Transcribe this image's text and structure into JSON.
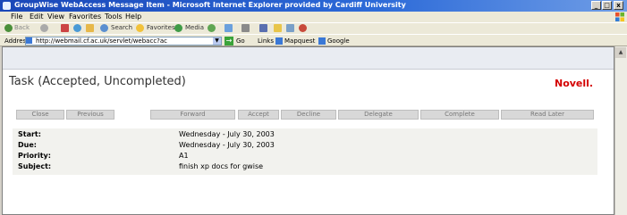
{
  "window": {
    "title": "GroupWise WebAccess Message Item - Microsoft Internet Explorer provided by Cardiff University",
    "minimize": "_",
    "maximize": "□",
    "close": "x"
  },
  "menu": [
    "File",
    "Edit",
    "View",
    "Favorites",
    "Tools",
    "Help"
  ],
  "toolbar": {
    "back": "Back",
    "search": "Search",
    "favorites": "Favorites",
    "media": "Media"
  },
  "address_bar": {
    "label": "Address",
    "url": "http://webmail.cf.ac.uk/servlet/webacc?ac",
    "go": "Go",
    "links_label": "Links",
    "link_1": "Mapquest",
    "link_2": "Google"
  },
  "task": {
    "title": "Task  (Accepted, Uncompleted)",
    "brand": "Novell."
  },
  "actions": [
    "Close",
    "Previous",
    "Forward",
    "Accept",
    "Decline",
    "Delegate",
    "Complete",
    "Read Later"
  ],
  "details": {
    "start_label": "Start:",
    "start_value": "Wednesday - July 30, 2003",
    "due_label": "Due:",
    "due_value": "Wednesday - July 30, 2003",
    "priority_label": "Priority:",
    "priority_value": "A1",
    "subject_label": "Subject:",
    "subject_value": "finish xp docs for gwise"
  },
  "colors": {
    "titlebar": "#1a47b8",
    "brand_red": "#d40000",
    "header_bg": "#e9ecf2"
  }
}
